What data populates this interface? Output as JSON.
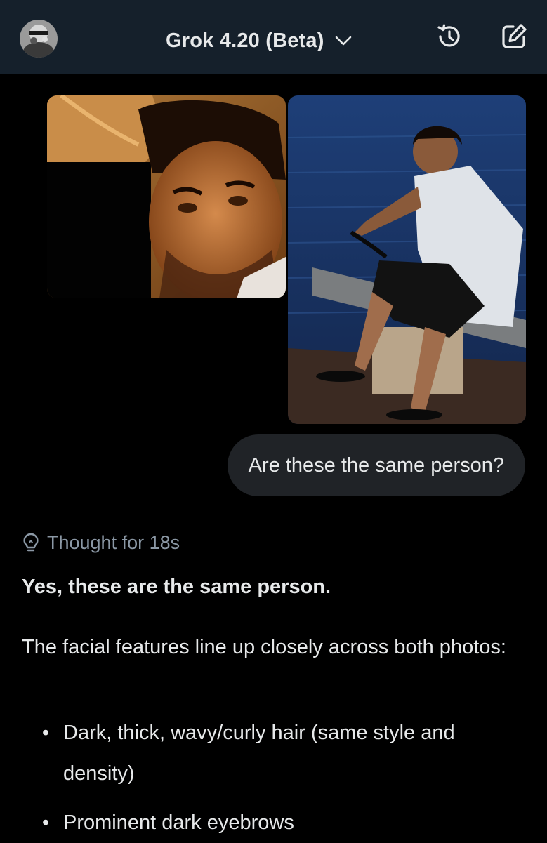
{
  "header": {
    "model_title": "Grok 4.20 (Beta)",
    "avatar_icon": "user-avatar",
    "dropdown_icon": "chevron-down-icon",
    "history_icon": "history-icon",
    "compose_icon": "new-chat-icon",
    "background_color": "#15202b"
  },
  "attachments": {
    "count": 2,
    "items": [
      {
        "description_icon": "photo-thumbnail-1"
      },
      {
        "description_icon": "photo-thumbnail-2"
      }
    ]
  },
  "user_message": {
    "text": "Are these the same person?"
  },
  "assistant": {
    "thought_label": "Thought for 18s",
    "thought_icon": "lightbulb-icon",
    "headline": "Yes, these are the same person.",
    "paragraph": "The facial features line up closely across both photos:",
    "bullets": [
      "Dark, thick, wavy/curly hair (same style and density)",
      "Prominent dark eyebrows"
    ]
  },
  "colors": {
    "background": "#000000",
    "text_primary": "#e7e9ea",
    "text_secondary": "#8b98a5",
    "bubble": "#202327"
  }
}
